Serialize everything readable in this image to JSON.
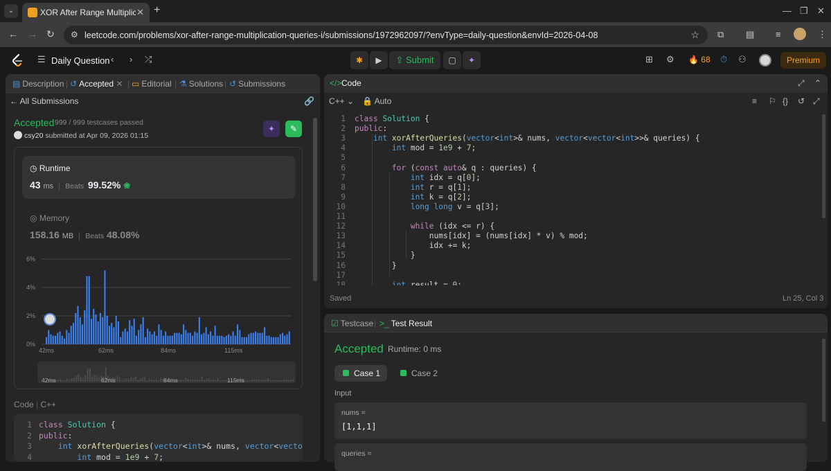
{
  "browser": {
    "tab_title": "XOR After Range Multiplicati",
    "url": "leetcode.com/problems/xor-after-range-multiplication-queries-i/submissions/1972962097/?envType=daily-question&envId=2026-04-08"
  },
  "topbar": {
    "daily_label": "Daily Question",
    "submit_label": "Submit",
    "streak": "68",
    "premium_label": "Premium"
  },
  "left_tabs": [
    {
      "label": "Description"
    },
    {
      "label": "Accepted"
    },
    {
      "label": "Editorial"
    },
    {
      "label": "Solutions"
    },
    {
      "label": "Submissions"
    }
  ],
  "submission": {
    "back_label": "All Submissions",
    "status": "Accepted",
    "testcases": "999 / 999 testcases passed",
    "user": "csy20",
    "submitted_at": "submitted at Apr 09, 2026 01:15",
    "runtime_label": "Runtime",
    "runtime_value": "43",
    "runtime_unit": "ms",
    "beats_label": "Beats",
    "runtime_beats": "99.52%",
    "memory_label": "Memory",
    "memory_value": "158.16",
    "memory_unit": "MB",
    "memory_beats": "48.08%",
    "code_label": "Code",
    "code_lang": "C++"
  },
  "chart_data": {
    "type": "bar",
    "yticks": [
      "6%",
      "4%",
      "2%",
      "0%"
    ],
    "ylim": [
      0,
      6
    ],
    "xticks": [
      "42ms",
      "62ms",
      "84ms",
      "115ms"
    ],
    "mini_xticks": [
      "42ms",
      "62ms",
      "84ms",
      "115ms"
    ],
    "values": [
      0.5,
      1.0,
      0.7,
      0.6,
      0.6,
      0.8,
      0.9,
      0.6,
      0.4,
      1.0,
      0.8,
      1.3,
      1.5,
      2.2,
      2.7,
      1.9,
      1.4,
      2.4,
      4.8,
      4.8,
      1.8,
      2.5,
      2.1,
      1.6,
      2.2,
      1.9,
      5.2,
      2.0,
      1.3,
      1.5,
      1.2,
      2.0,
      1.6,
      0.5,
      0.9,
      1.1,
      0.9,
      1.7,
      1.3,
      1.8,
      0.6,
      1.0,
      1.4,
      1.9,
      0.5,
      1.1,
      0.9,
      0.7,
      0.9,
      0.6,
      1.4,
      1.0,
      0.6,
      0.9,
      0.6,
      0.6,
      0.6,
      0.8,
      0.8,
      0.8,
      0.7,
      1.4,
      1.0,
      0.8,
      0.8,
      0.6,
      0.9,
      0.8,
      1.9,
      0.7,
      0.8,
      1.2,
      0.7,
      0.9,
      0.6,
      1.3,
      0.6,
      0.6,
      0.6,
      0.5,
      0.6,
      0.7,
      0.6,
      0.9,
      0.6,
      1.4,
      1.0,
      0.5,
      0.5,
      0.5,
      0.7,
      0.8,
      0.8,
      0.9,
      0.8,
      0.8,
      0.8,
      1.2,
      0.6,
      0.6,
      0.5,
      0.5,
      0.5,
      0.5,
      0.7,
      0.8,
      0.6,
      0.7,
      0.9
    ]
  },
  "code_panel": {
    "title": "Code",
    "lang": "C++",
    "mode": "Auto",
    "status": "Saved",
    "cursor": "Ln 25, Col 3"
  },
  "code_lines": [
    "class Solution {",
    "public:",
    "    int xorAfterQueries(vector<int>& nums, vector<vector<int>>& queries) {",
    "        int mod = 1e9 + 7;",
    "",
    "        for (const auto& q : queries) {",
    "            int idx = q[0];",
    "            int r = q[1];",
    "            int k = q[2];",
    "            long long v = q[3];",
    "",
    "            while (idx <= r) {",
    "                nums[idx] = (nums[idx] * v) % mod;",
    "                idx += k;",
    "            }",
    "        }",
    "",
    "        int result = 0;"
  ],
  "left_code_lines": [
    "class Solution {",
    "public:",
    "    int xorAfterQueries(vector<int>& nums, vector<vector<ir",
    "        int mod = 1e9 + 7;"
  ],
  "test": {
    "testcase_tab": "Testcase",
    "result_tab": "Test Result",
    "status": "Accepted",
    "runtime": "Runtime: 0 ms",
    "cases": [
      "Case 1",
      "Case 2"
    ],
    "input_label": "Input",
    "vars": [
      {
        "name": "nums =",
        "value": "[1,1,1]"
      },
      {
        "name": "queries =",
        "value": ""
      }
    ]
  },
  "colors": {
    "accent_green": "#2cbb5d",
    "bar_blue": "#3b82f6",
    "premium_orange": "#ffa116"
  }
}
